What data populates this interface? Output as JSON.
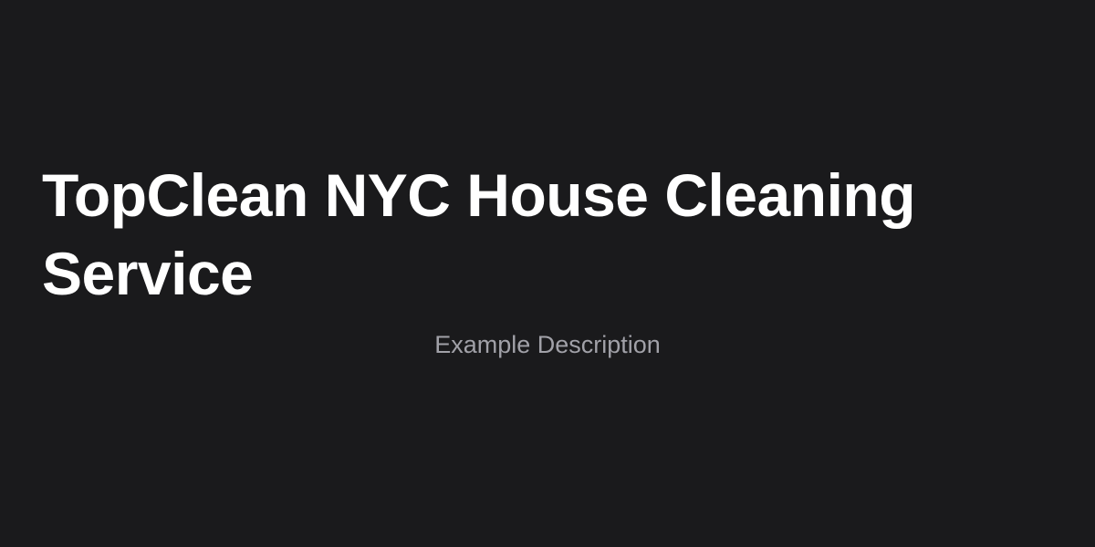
{
  "card": {
    "title": "TopClean NYC House Cleaning Service",
    "description": "Example Description"
  },
  "colors": {
    "background": "#1a1a1c",
    "title": "#ffffff",
    "description": "#a1a1a8"
  }
}
